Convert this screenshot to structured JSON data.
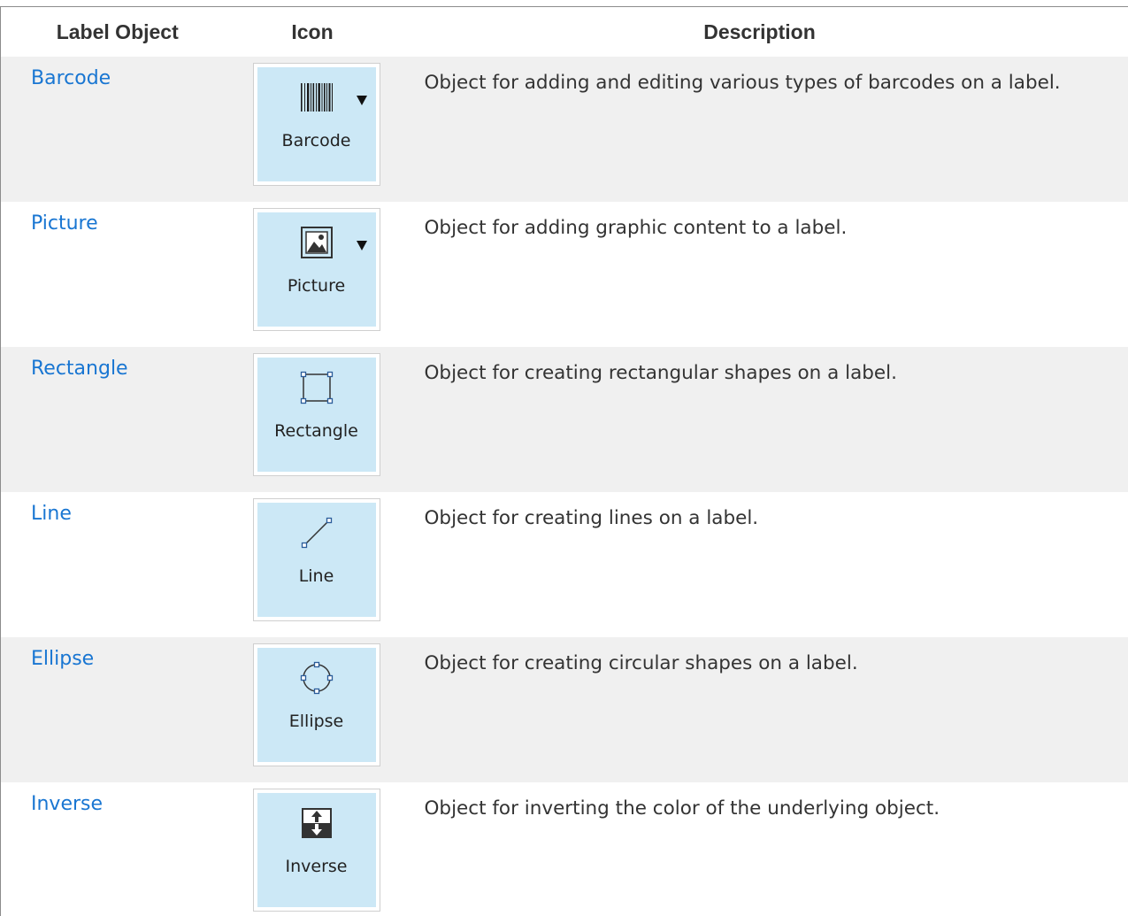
{
  "table": {
    "headers": {
      "label_object": "Label Object",
      "icon": "Icon",
      "description": "Description"
    },
    "rows": [
      {
        "name": "Barcode",
        "icon_label": "Barcode",
        "icon": "barcode-icon",
        "has_dropdown": true,
        "description": "Object for adding and editing various types of barcodes on a label."
      },
      {
        "name": "Picture",
        "icon_label": "Picture",
        "icon": "picture-icon",
        "has_dropdown": true,
        "description": "Object for adding graphic content to a label."
      },
      {
        "name": "Rectangle",
        "icon_label": "Rectangle",
        "icon": "rectangle-icon",
        "has_dropdown": false,
        "description": "Object for creating rectangular shapes on a label."
      },
      {
        "name": "Line",
        "icon_label": "Line",
        "icon": "line-icon",
        "has_dropdown": false,
        "description": "Object for creating lines on a label."
      },
      {
        "name": "Ellipse",
        "icon_label": "Ellipse",
        "icon": "ellipse-icon",
        "has_dropdown": false,
        "description": "Object for creating circular shapes on a label."
      },
      {
        "name": "Inverse",
        "icon_label": "Inverse",
        "icon": "inverse-icon",
        "has_dropdown": false,
        "description": "Object for inverting the color of the underlying object."
      }
    ]
  },
  "colors": {
    "link": "#1976d2",
    "row_shade": "#f0f0f0",
    "icon_button": "#cce8f6",
    "handle": "#2a5c9a"
  }
}
